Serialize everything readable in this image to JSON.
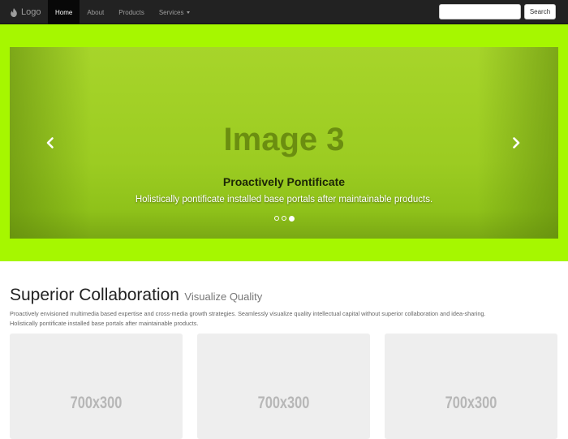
{
  "navbar": {
    "brand": "Logo",
    "items": [
      {
        "label": "Home"
      },
      {
        "label": "About"
      },
      {
        "label": "Products"
      },
      {
        "label": "Services"
      }
    ],
    "search": {
      "placeholder": "",
      "button_label": "Search"
    }
  },
  "hero": {
    "slide_label": "Image 3",
    "caption_title": "Proactively Pontificate",
    "caption_text": "Holistically pontificate installed base portals after maintainable products.",
    "slide_count": 3,
    "active_slide": 3
  },
  "section": {
    "title": "Superior Collaboration",
    "subtitle": "Visualize Quality",
    "intro_line_1": "Proactively envisioned multimedia based expertise and cross-media growth strategies. Seamlessly visualize quality intellectual capital without superior collaboration and idea-sharing.",
    "intro_line_2": "Holistically pontificate installed base portals after maintainable products."
  },
  "thumbnails": [
    {
      "label": "700x300"
    },
    {
      "label": "700x300"
    },
    {
      "label": "700x300"
    }
  ],
  "icons": {
    "brand": "flame-icon",
    "prev": "chevron-left-icon",
    "next": "chevron-right-icon",
    "dropdown": "caret-down-icon"
  },
  "colors": {
    "navbar_bg": "#222222",
    "hero_bg": "#a6f700",
    "slide_bg": "#9ccc22",
    "thumb_bg": "#eeeeee"
  }
}
